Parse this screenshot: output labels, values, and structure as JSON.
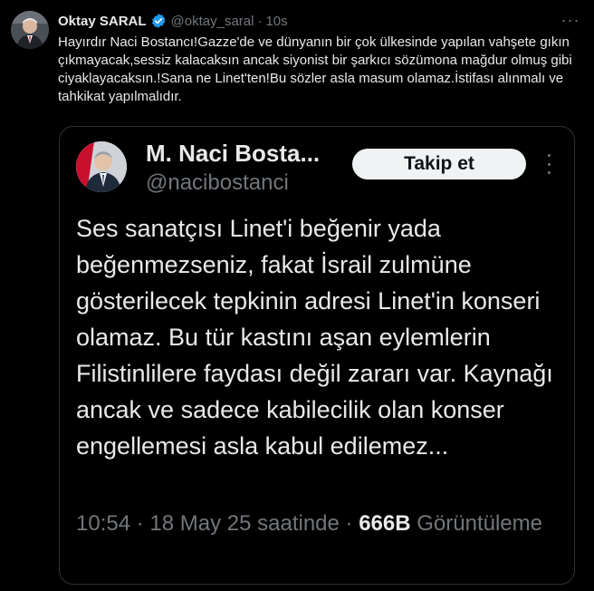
{
  "post": {
    "author_name": "Oktay SARAL",
    "handle": "@oktay_saral",
    "separator": "·",
    "time": "10s",
    "more_label": "···",
    "text": "Hayırdır Naci Bostancı!Gazze'de ve dünyanın bir çok ülkesinde yapılan vahşete gıkın çıkmayacak,sessiz kalacaksın ancak siyonist bir şarkıcı sözümona mağdur olmuş gibi ciyaklayacaksın.!Sana ne Linet'ten!Bu sözler asla masum olamaz.İstifası alınmalı ve tahkikat yapılmalıdır.",
    "verified_color": "#1d9bf0"
  },
  "quoted": {
    "author_name": "M. Naci Bosta...",
    "handle": "@nacibostanci",
    "follow_label": "Takip et",
    "text": "Ses sanatçısı Linet'i beğenir yada beğenmezseniz, fakat İsrail zulmüne gösterilecek tepkinin adresi Linet'in konseri olamaz. Bu tür kastını aşan eylemlerin Filistinlilere faydası değil zararı var. Kaynağı ancak ve sadece kabilecilik olan konser engellemesi asla kabul edilemez...",
    "timestamp": "10:54 · 18 May 25 saatinde ·",
    "views_count": "666B",
    "views_label": "Görüntüleme"
  }
}
